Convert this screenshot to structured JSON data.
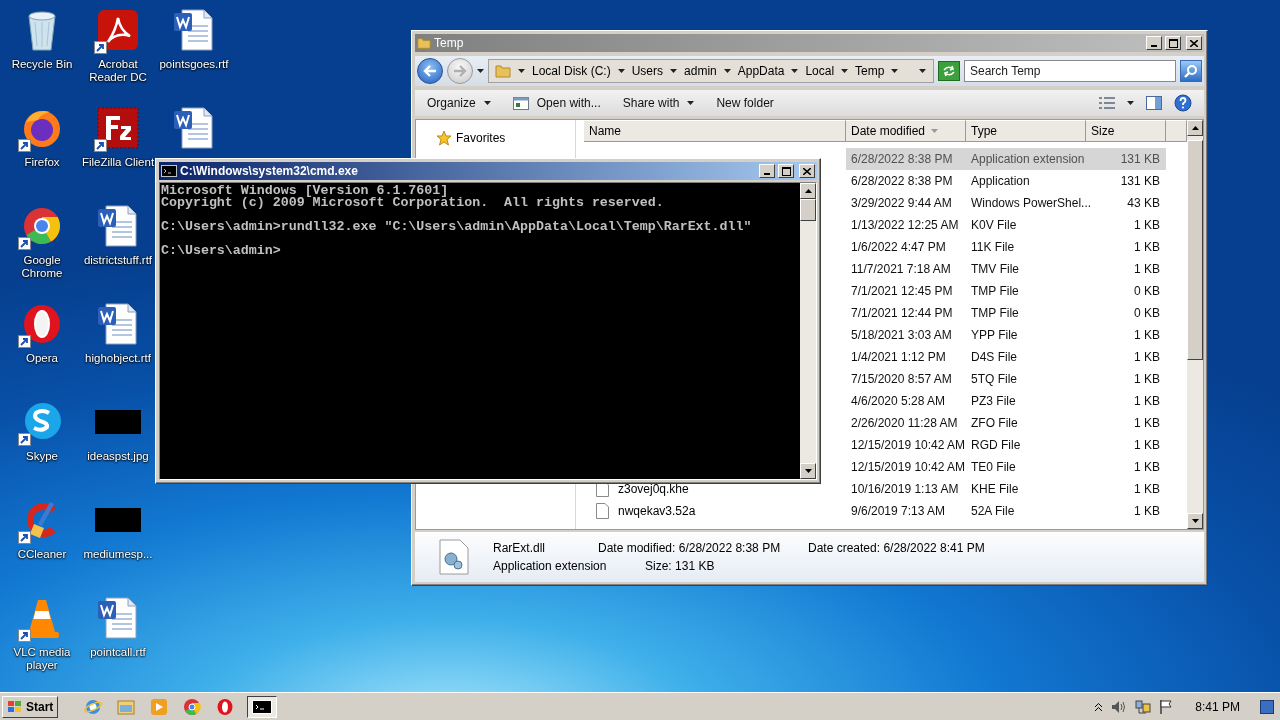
{
  "desktop_icons": [
    {
      "label": "Recycle Bin",
      "kind": "recycle",
      "shortcut": false
    },
    {
      "label": "Firefox",
      "kind": "firefox",
      "shortcut": true
    },
    {
      "label": "Google Chrome",
      "kind": "chrome",
      "shortcut": true
    },
    {
      "label": "Opera",
      "kind": "opera",
      "shortcut": true
    },
    {
      "label": "Skype",
      "kind": "skype",
      "shortcut": true
    },
    {
      "label": "CCleaner",
      "kind": "ccleaner",
      "shortcut": true
    },
    {
      "label": "VLC media player",
      "kind": "vlc",
      "shortcut": true
    },
    {
      "label": "Acrobat Reader DC",
      "kind": "acrobat",
      "shortcut": true
    },
    {
      "label": "FileZilla Client",
      "kind": "filezilla",
      "shortcut": true
    },
    {
      "label": "districtstuff.rtf",
      "kind": "word",
      "shortcut": false
    },
    {
      "label": "highobject.rtf",
      "kind": "word",
      "shortcut": false
    },
    {
      "label": "ideaspst.jpg",
      "kind": "image",
      "shortcut": false
    },
    {
      "label": "mediumesp...",
      "kind": "image",
      "shortcut": false
    },
    {
      "label": "pointcall.rtf",
      "kind": "word",
      "shortcut": false
    },
    {
      "label": "pointsgoes.rtf",
      "kind": "word",
      "shortcut": false
    },
    {
      "kind": "word",
      "shortcut": false
    }
  ],
  "explorer": {
    "title": "Temp",
    "active": false,
    "breadcrumb": [
      "Local Disk (C:)",
      "Users",
      "admin",
      "AppData",
      "Local",
      "Temp"
    ],
    "search": {
      "placeholder": "Search Temp"
    },
    "toolbar": [
      {
        "label": "Organize",
        "menu": true,
        "icon": false
      },
      {
        "label": "Open with...",
        "menu": false,
        "icon": true
      },
      {
        "label": "Share with",
        "menu": true,
        "icon": false
      },
      {
        "label": "New folder",
        "menu": false,
        "icon": false
      }
    ],
    "nav": [
      {
        "label": "Favorites"
      }
    ],
    "columns": [
      {
        "label": "Name",
        "sorted": false
      },
      {
        "label": "Date modified",
        "sorted": true
      },
      {
        "label": "Type",
        "sorted": false
      },
      {
        "label": "Size",
        "sorted": false
      }
    ],
    "rows": [
      {
        "date": "6/28/2022 8:38 PM",
        "type": "Application extension",
        "size": "131 KB",
        "selected": true
      },
      {
        "date": "6/28/2022 8:38 PM",
        "type": "Application",
        "size": "131 KB",
        "selected": false
      },
      {
        "date": "3/29/2022 9:44 AM",
        "type": "Windows PowerShel...",
        "size": "43 KB",
        "selected": false
      },
      {
        "date": "1/13/2022 12:25 AM",
        "type": "K0V File",
        "size": "1 KB",
        "selected": false
      },
      {
        "date": "1/6/2022 4:47 PM",
        "type": "11K File",
        "size": "1 KB",
        "selected": false
      },
      {
        "date": "11/7/2021 7:18 AM",
        "type": "TMV File",
        "size": "1 KB",
        "selected": false
      },
      {
        "date": "7/1/2021 12:45 PM",
        "type": "TMP File",
        "size": "0 KB",
        "selected": false
      },
      {
        "date": "7/1/2021 12:44 PM",
        "type": "TMP File",
        "size": "0 KB",
        "selected": false
      },
      {
        "date": "5/18/2021 3:03 AM",
        "type": "YPP File",
        "size": "1 KB",
        "selected": false
      },
      {
        "date": "1/4/2021 1:12 PM",
        "type": "D4S File",
        "size": "1 KB",
        "selected": false
      },
      {
        "date": "7/15/2020 8:57 AM",
        "type": "5TQ File",
        "size": "1 KB",
        "selected": false
      },
      {
        "date": "4/6/2020 5:28 AM",
        "type": "PZ3 File",
        "size": "1 KB",
        "selected": false
      },
      {
        "date": "2/26/2020 11:28 AM",
        "type": "ZFO File",
        "size": "1 KB",
        "selected": false
      },
      {
        "date": "12/15/2019 10:42 AM",
        "type": "RGD File",
        "size": "1 KB",
        "selected": false
      },
      {
        "date": "12/15/2019 10:42 AM",
        "type": "TE0 File",
        "size": "1 KB",
        "selected": false
      },
      {
        "name": "z3ovej0q.khe",
        "date": "10/16/2019 1:13 AM",
        "type": "KHE File",
        "size": "1 KB",
        "selected": false
      },
      {
        "name": "nwqekav3.52a",
        "date": "9/6/2019 7:13 AM",
        "type": "52A File",
        "size": "1 KB",
        "selected": false
      }
    ],
    "details": {
      "name": "RarExt.dll",
      "type": "Application extension",
      "modified_label": "Date modified:",
      "modified": "6/28/2022 8:38 PM",
      "created_label": "Date created:",
      "created": "6/28/2022 8:41 PM",
      "size_label": "Size:",
      "size": "131 KB"
    }
  },
  "cmd": {
    "title": "C:\\Windows\\system32\\cmd.exe",
    "active": true,
    "blocks": [
      [
        "Microsoft Windows [Version 6.1.7601]",
        "Copyright (c) 2009 Microsoft Corporation.  All rights reserved."
      ],
      [
        "C:\\Users\\admin>rundll32.exe \"C:\\Users\\admin\\AppData\\Local\\Temp\\RarExt.dll\""
      ],
      [
        "C:\\Users\\admin>"
      ]
    ]
  },
  "taskbar": {
    "start": "Start",
    "apps": [
      {
        "kind": "ie",
        "active": false
      },
      {
        "kind": "explorer",
        "active": false
      },
      {
        "kind": "media",
        "active": false
      },
      {
        "kind": "chrome",
        "active": false
      },
      {
        "kind": "opera",
        "active": false
      },
      {
        "kind": "cmd",
        "active": true
      }
    ],
    "clock": "8:41 PM"
  }
}
